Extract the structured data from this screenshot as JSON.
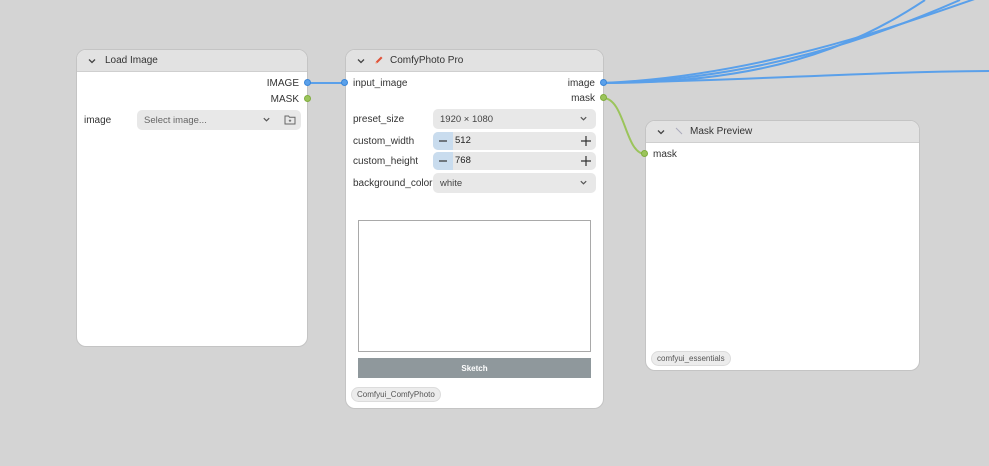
{
  "colors": {
    "canvas_bg": "#d4d4d4",
    "link_blue": "#5aa0ea",
    "link_green": "#9bc45b",
    "node_bg": "#ffffff",
    "header_bg": "#e2e2e2",
    "sketch_button": "#8f989c"
  },
  "load_image": {
    "title": "Load Image",
    "outputs": [
      "IMAGE",
      "MASK"
    ],
    "image_label": "image",
    "image_placeholder": "Select image...",
    "icons": [
      "chevron-down-icon",
      "folder-icon"
    ]
  },
  "comfyphoto": {
    "title": "ComfyPhoto Pro",
    "title_icon": "pencil-icon",
    "input": "input_image",
    "outputs": [
      "image",
      "mask"
    ],
    "preset_size_label": "preset_size",
    "preset_size_value": "1920 × 1080",
    "custom_width_label": "custom_width",
    "custom_width_value": "512",
    "custom_height_label": "custom_height",
    "custom_height_value": "768",
    "background_color_label": "background_color",
    "background_color_value": "white",
    "sketch_label": "Sketch",
    "badge": "Comfyui_ComfyPhoto"
  },
  "mask_preview": {
    "title": "Mask Preview",
    "input": "mask",
    "badge": "comfyui_essentials"
  }
}
